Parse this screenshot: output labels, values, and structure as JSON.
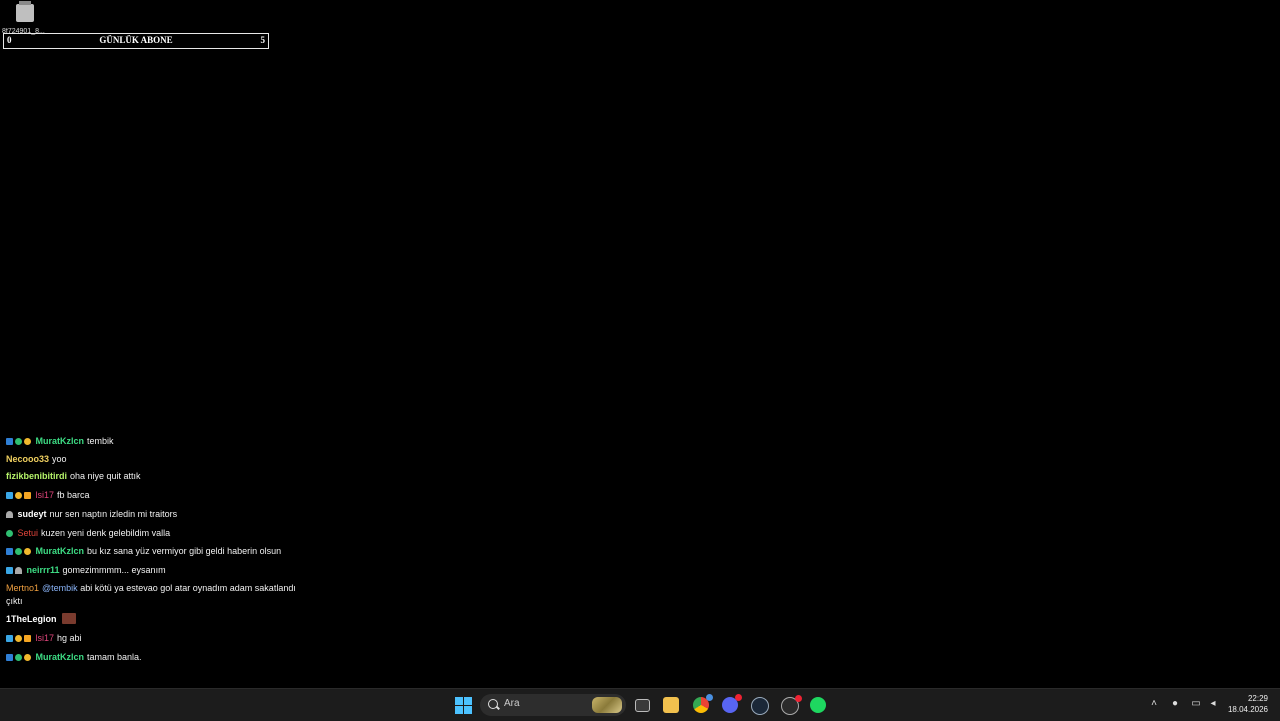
{
  "desktop": {
    "icon_label": "8f724901_8..."
  },
  "goal_bar": {
    "left_value": "0",
    "title": "GÜNLÜK ABONE",
    "right_value": "5"
  },
  "chat": {
    "messages": [
      {
        "user": "MuratKzlcn",
        "user_color": "#3ddc84",
        "text": "tembik"
      },
      {
        "user": "Necooo33",
        "user_color": "#f0d060",
        "text": "yoo"
      },
      {
        "user": "fizikbenibitirdi",
        "user_color": "#b6f56a",
        "text": "oha niye quit attık"
      },
      {
        "user": "lsi17",
        "user_color": "#e0457b",
        "text": "fb barca"
      },
      {
        "user": "sudeyt",
        "user_color": "#ffffff",
        "text": "nur sen naptın izledin mi traitors"
      },
      {
        "user": "Setui",
        "user_color": "#e0453b",
        "text": "kuzen yeni denk gelebildim valla"
      },
      {
        "user": "MuratKzlcn",
        "user_color": "#3ddc84",
        "text": "bu kız sana yüz vermiyor gibi geldi haberin olsun"
      },
      {
        "user": "neirrr11",
        "user_color": "#3ddc84",
        "text": "gomezimmmm... eysanım"
      },
      {
        "user": "Mertno1",
        "user_color": "#f0a040",
        "mention": "@tembik",
        "text": "abi kötü ya estevao gol atar oynadım adam sakatlandı çıktı"
      },
      {
        "user": "1TheLegion",
        "user_color": "#ffffff",
        "text": ""
      },
      {
        "user": "lsi17",
        "user_color": "#e0457b",
        "text": "hg abi"
      },
      {
        "user": "MuratKzlcn",
        "user_color": "#3ddc84",
        "text": "tamam banla."
      }
    ]
  },
  "taskbar": {
    "search_placeholder": "Ara",
    "time": "22:29",
    "date": "18.04.2026",
    "apps": [
      "start-icon",
      "search-icon",
      "task-view-icon",
      "file-explorer-icon",
      "chrome-icon",
      "discord-icon",
      "steam-icon",
      "obs-icon",
      "spotify-icon"
    ],
    "tray": [
      "chevron-up-icon",
      "microphone-icon",
      "network-icon",
      "volume-icon"
    ],
    "colors": {
      "accent": "#4cc2ff",
      "spotify": "#1ed760"
    }
  }
}
